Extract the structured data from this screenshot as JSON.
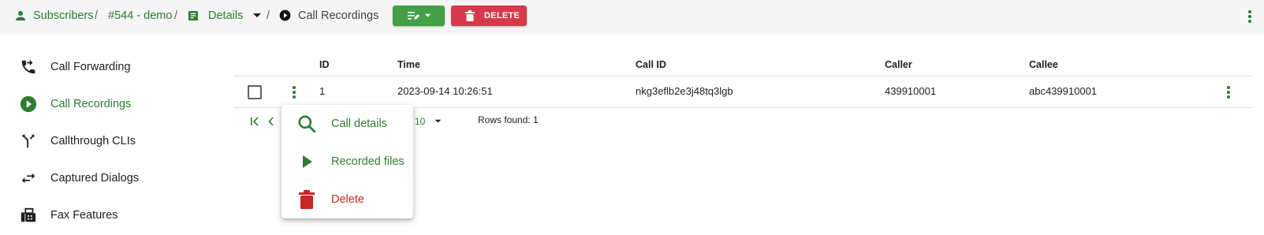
{
  "breadcrumb": {
    "subscribers": "Subscribers",
    "subscriber": "#544 - demo",
    "details": "Details",
    "current": "Call Recordings",
    "separator": "/"
  },
  "toolbar": {
    "delete_label": "DELETE"
  },
  "sidebar": {
    "items": [
      {
        "label": "Call Forwarding",
        "icon": "phone-forward-icon",
        "active": false
      },
      {
        "label": "Call Recordings",
        "icon": "play-circle-icon",
        "active": true
      },
      {
        "label": "Callthrough CLIs",
        "icon": "call-split-icon",
        "active": false
      },
      {
        "label": "Captured Dialogs",
        "icon": "swap-horiz-icon",
        "active": false
      },
      {
        "label": "Fax Features",
        "icon": "fax-icon",
        "active": false
      }
    ]
  },
  "table": {
    "columns": [
      "ID",
      "Time",
      "Call ID",
      "Caller",
      "Callee"
    ],
    "rows": [
      {
        "id": "1",
        "time": "2023-09-14 10:26:51",
        "call_id": "nkg3eflb2e3j48tq3lgb",
        "caller": "439910001",
        "callee": "abc439910001"
      }
    ]
  },
  "pagination": {
    "rows_per_page": "10",
    "rows_found": "Rows found: 1"
  },
  "context_menu": {
    "items": [
      {
        "label": "Call details",
        "icon": "magnify-icon"
      },
      {
        "label": "Recorded files",
        "icon": "play-icon"
      },
      {
        "label": "Delete",
        "icon": "trash-icon"
      }
    ]
  },
  "colors": {
    "primary": "#2e7d32",
    "edit_button": "#43a047",
    "delete_button": "#d63a4a",
    "danger_text": "#c62828",
    "topbar_bg": "#f5f5f5"
  }
}
